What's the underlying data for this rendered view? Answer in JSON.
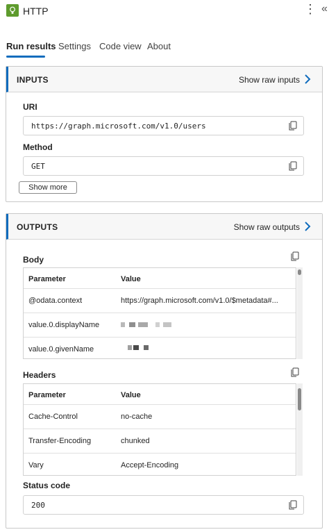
{
  "header": {
    "title": "HTTP",
    "icon": "lightbulb-icon",
    "more_label": "⋮",
    "collapse_label": "«"
  },
  "tabs": [
    {
      "label": "Run results",
      "active": true
    },
    {
      "label": "Settings",
      "active": false
    },
    {
      "label": "Code view",
      "active": false
    },
    {
      "label": "About",
      "active": false
    }
  ],
  "inputs": {
    "title": "INPUTS",
    "raw_link": "Show raw inputs",
    "uri_label": "URI",
    "uri_value": "https://graph.microsoft.com/v1.0/users",
    "method_label": "Method",
    "method_value": "GET",
    "show_more": "Show more"
  },
  "outputs": {
    "title": "OUTPUTS",
    "raw_link": "Show raw outputs",
    "body_label": "Body",
    "body_table": {
      "headers": [
        "Parameter",
        "Value"
      ],
      "rows": [
        [
          "@odata.context",
          "https://graph.microsoft.com/v1.0/$metadata#..."
        ],
        [
          "value.0.displayName",
          ""
        ],
        [
          "value.0.givenName",
          ""
        ]
      ]
    },
    "headers_label": "Headers",
    "headers_table": {
      "headers": [
        "Parameter",
        "Value"
      ],
      "rows": [
        [
          "Cache-Control",
          "no-cache"
        ],
        [
          "Transfer-Encoding",
          "chunked"
        ],
        [
          "Vary",
          "Accept-Encoding"
        ]
      ]
    },
    "status_label": "Status code",
    "status_value": "200"
  },
  "colors": {
    "accent": "#0f6cbd",
    "app_icon": "#5e9b2d"
  }
}
